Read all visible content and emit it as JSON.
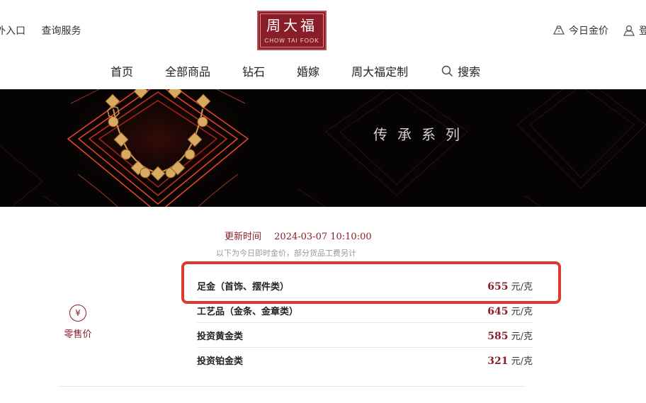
{
  "header": {
    "top_left": [
      "外入口",
      "查询服务"
    ],
    "logo": {
      "cn": "周大福",
      "en": "CHOW TAI FOOK"
    },
    "top_right": [
      {
        "label": "今日金价",
        "icon": "gold-bar-icon"
      },
      {
        "label": "登",
        "icon": "user-icon"
      }
    ],
    "nav": [
      "首页",
      "全部商品",
      "钻石",
      "婚嫁",
      "周大福定制"
    ],
    "search_label": "搜索"
  },
  "banner": {
    "title": "传承系列"
  },
  "prices": {
    "update_label": "更新时间",
    "update_time": "2024-03-07 10:10:00",
    "note": "以下为今日即时金价，部分货品工费另计",
    "retail_label": "零售价",
    "retail_icon": "yuan-coin-icon",
    "coin_glyph": "¥",
    "rows": [
      {
        "name": "足金（首饰、摆件类）",
        "value": "655",
        "unit": "元/克"
      },
      {
        "name": "工艺品（金条、金章类）",
        "value": "645",
        "unit": "元/克"
      },
      {
        "name": "投资黄金类",
        "value": "585",
        "unit": "元/克"
      },
      {
        "name": "投资铂金类",
        "value": "321",
        "unit": "元/克"
      }
    ]
  },
  "colors": {
    "brand": "#8a1e28",
    "highlight": "#e0392b",
    "banner_bg": "#050303"
  }
}
